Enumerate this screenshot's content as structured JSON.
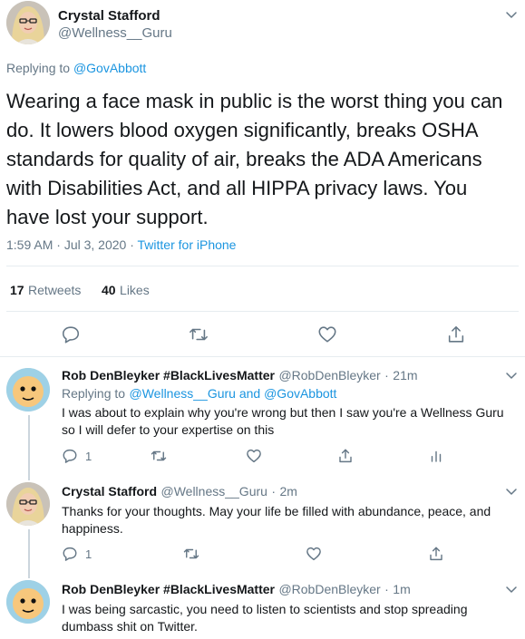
{
  "main_tweet": {
    "author_name": "Crystal Stafford",
    "author_handle": "@Wellness__Guru",
    "replying_prefix": "Replying to",
    "replying_to": "@GovAbbott",
    "text": "Wearing a face mask in public is the worst thing you can do. It lowers blood oxygen significantly, breaks OSHA standards for quality of air, breaks the ADA Americans with Disabilities Act, and all HIPPA privacy laws. You have lost your support.",
    "time": "1:59 AM",
    "date": "Jul 3, 2020",
    "separator": "·",
    "source": "Twitter for iPhone",
    "retweets_count": "17",
    "retweets_label": "Retweets",
    "likes_count": "40",
    "likes_label": "Likes"
  },
  "replies": [
    {
      "author_name": "Rob DenBleyker #BlackLivesMatter",
      "author_handle": "@RobDenBleyker",
      "time_ago": "21m",
      "replying_prefix": "Replying to",
      "replying_to": "@Wellness__Guru and @GovAbbott",
      "text": "I was about to explain why you're wrong but then I saw you're a Wellness Guru so I will defer to your expertise on this",
      "reply_count": "1"
    },
    {
      "author_name": "Crystal Stafford",
      "author_handle": "@Wellness__Guru",
      "time_ago": "2m",
      "text": "Thanks for your thoughts. May your life be filled with abundance, peace, and happiness.",
      "reply_count": "1"
    },
    {
      "author_name": "Rob DenBleyker #BlackLivesMatter",
      "author_handle": "@RobDenBleyker",
      "time_ago": "1m",
      "text": "I was being sarcastic, you need to listen to scientists and stop spreading dumbass shit on Twitter."
    }
  ],
  "separator": "·",
  "colors": {
    "link": "#1b95e0",
    "muted": "#657786",
    "text": "#14171a",
    "divider": "#e6ecf0"
  },
  "icons": {
    "reply": "reply-icon",
    "retweet": "retweet-icon",
    "like": "heart-icon",
    "share": "share-icon",
    "analytics": "analytics-icon",
    "more": "chevron-down-icon"
  }
}
